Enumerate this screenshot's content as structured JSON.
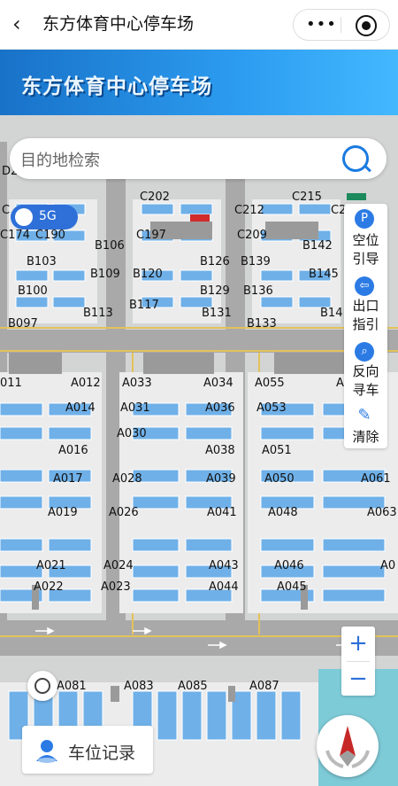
{
  "app": {
    "title": "东方体育中心停车场"
  },
  "banner": {
    "title": "东方体育中心停车场"
  },
  "search": {
    "placeholder": "目的地检索"
  },
  "network": {
    "label": "5G"
  },
  "side_panel": [
    {
      "line1": "空位",
      "line2": "引导",
      "icon": "parking-icon"
    },
    {
      "line1": "出口",
      "line2": "指引",
      "icon": "exit-icon"
    },
    {
      "line1": "反向",
      "line2": "寻车",
      "icon": "car-search-icon"
    },
    {
      "line1": "清除",
      "line2": "",
      "icon": "broom-icon"
    }
  ],
  "zoom": {
    "in": "+",
    "out": "−"
  },
  "record": {
    "label": "车位记录"
  },
  "map_labels": {
    "c_row1": [
      "D2",
      "C202",
      "C215",
      "C2"
    ],
    "c_row2": [
      "C",
      "C212"
    ],
    "c_row3": [
      "C174",
      "C190",
      "C197",
      "C209"
    ],
    "b_row1": [
      "B106",
      "B142"
    ],
    "b_row2": [
      "B103",
      "B126",
      "B139"
    ],
    "b_row3": [
      "B109",
      "B120",
      "B145"
    ],
    "b_row4": [
      "B100",
      "B129",
      "B136"
    ],
    "b_row5": [
      "B117",
      "B14"
    ],
    "b_row6": [
      "B113",
      "B131"
    ],
    "b_row7": [
      "B097",
      "B133"
    ],
    "a_row1": [
      "011",
      "A012",
      "A033",
      "A034",
      "A055",
      "A"
    ],
    "a_row2": [
      "A014",
      "A031",
      "A036",
      "A053"
    ],
    "a_row3": [
      "A030"
    ],
    "a_row4": [
      "A016",
      "A038",
      "A051"
    ],
    "a_row5": [
      "A017",
      "A028",
      "A039",
      "A050",
      "A061"
    ],
    "a_row6": [
      "A019",
      "A026",
      "A041",
      "A048",
      "A063"
    ],
    "a_row7": [
      "A021",
      "A024",
      "A043",
      "A046",
      "A0"
    ],
    "a_row8": [
      "A022",
      "A023",
      "A044",
      "A045"
    ],
    "a_row9": [
      "A081",
      "A083",
      "A085",
      "A087"
    ]
  },
  "colors": {
    "accent": "#2c7be5",
    "slot": "#6fb0e8",
    "lane_line": "#e3c25a"
  }
}
